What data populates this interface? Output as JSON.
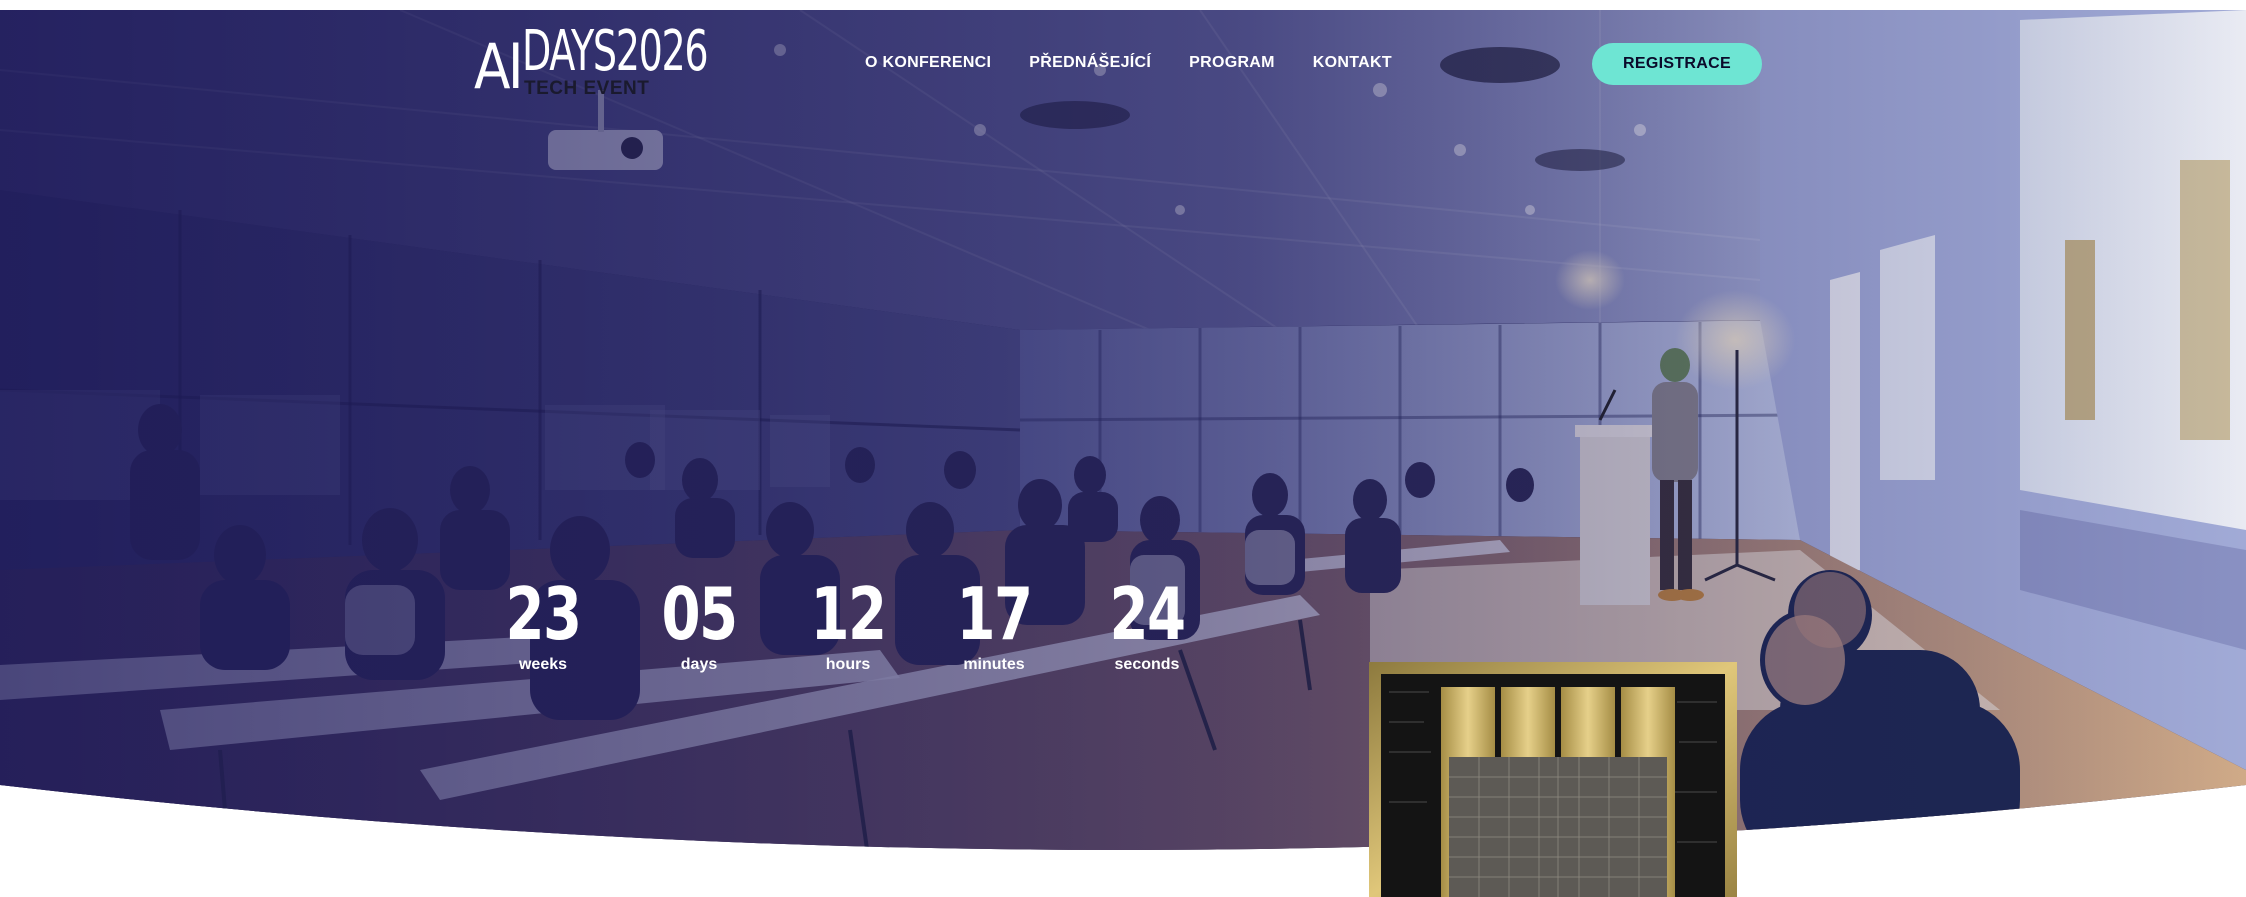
{
  "brand": {
    "logo_ai": "AI",
    "logo_days": "DAYS2026",
    "logo_sub": "TECH EVENT"
  },
  "nav": {
    "items": [
      "O KONFERENCI",
      "PŘEDNÁŠEJÍCÍ",
      "PROGRAM",
      "KONTAKT"
    ]
  },
  "cta": {
    "label": "REGISTRACE"
  },
  "countdown": {
    "weeks": {
      "value": "23",
      "label": "weeks"
    },
    "days": {
      "value": "05",
      "label": "days"
    },
    "hours": {
      "value": "12",
      "label": "hours"
    },
    "minutes": {
      "value": "17",
      "label": "minutes"
    },
    "seconds": {
      "value": "24",
      "label": "seconds"
    }
  },
  "colors": {
    "accent": "#6ee5d3",
    "overlay": "#1e1a5c",
    "chip_gold": "#c6a64e"
  }
}
